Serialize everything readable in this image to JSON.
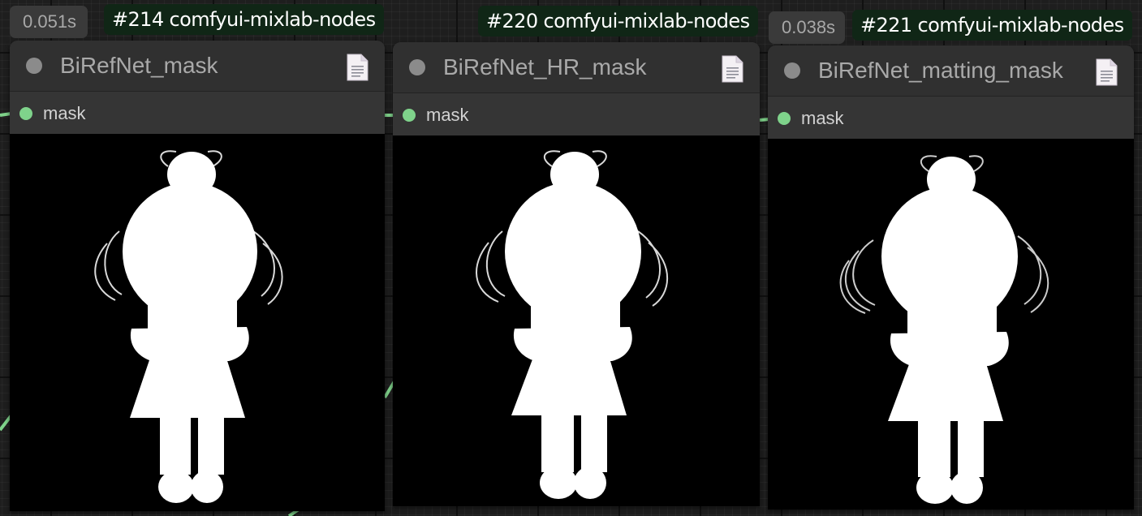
{
  "nodes": [
    {
      "exec_time": "0.051s",
      "badge": "#214 comfyui-mixlab-nodes",
      "title": "BiRefNet_mask",
      "output_label": "mask"
    },
    {
      "exec_time": "",
      "badge": "#220 comfyui-mixlab-nodes",
      "title": "BiRefNet_HR_mask",
      "output_label": "mask"
    },
    {
      "exec_time": "0.038s",
      "badge": "#221 comfyui-mixlab-nodes",
      "title": "BiRefNet_matting_mask",
      "output_label": "mask"
    }
  ],
  "colors": {
    "canvas_bg": "#1e1e1e",
    "node_body": "#353535",
    "badge_bg": "#102616",
    "slot_dot": "#7fd38b",
    "link": "#7fd38b",
    "mask_fg": "#ffffff",
    "mask_bg": "#000000"
  },
  "icons": {
    "collapse": "circle-icon",
    "docs": "document-icon",
    "output_slot": "green-dot-icon"
  }
}
